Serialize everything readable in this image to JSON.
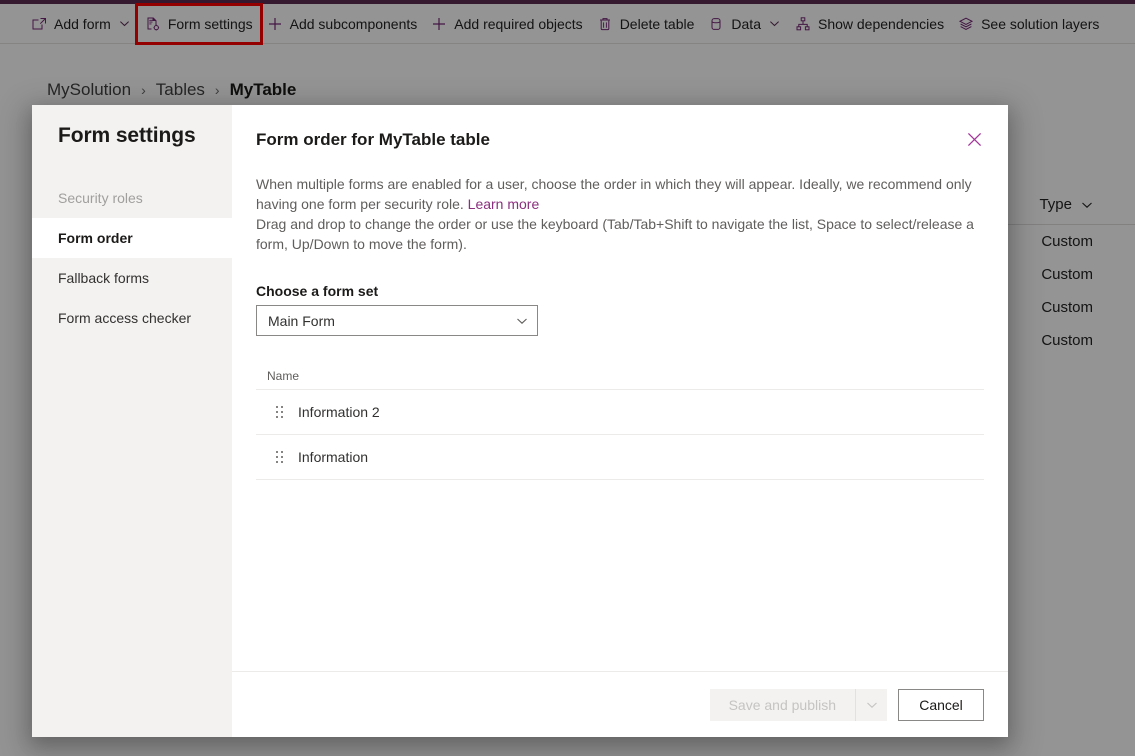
{
  "theme": {
    "accent_purple": "#5c2d52",
    "icon_purple": "#742774",
    "link_magenta": "#8b2e7e",
    "highlight_red": "#ff0000",
    "nav_selected_bg": "#ffffff",
    "nav_bg": "#f3f2f1"
  },
  "command_bar": {
    "items": [
      {
        "label": "Add form",
        "icon": "add-form-icon",
        "has_chevron": true
      },
      {
        "label": "Form settings",
        "icon": "form-settings-icon",
        "has_chevron": false,
        "highlighted": true
      },
      {
        "label": "Add subcomponents",
        "icon": "plus-icon",
        "has_chevron": false
      },
      {
        "label": "Add required objects",
        "icon": "plus-icon",
        "has_chevron": false
      },
      {
        "label": "Delete table",
        "icon": "trash-icon",
        "has_chevron": false
      },
      {
        "label": "Data",
        "icon": "database-icon",
        "has_chevron": true
      },
      {
        "label": "Show dependencies",
        "icon": "dependencies-icon",
        "has_chevron": false
      },
      {
        "label": "See solution layers",
        "icon": "layers-icon",
        "has_chevron": false
      }
    ]
  },
  "breadcrumb": {
    "separator": "›",
    "items": [
      {
        "label": "MySolution",
        "current": false
      },
      {
        "label": "Tables",
        "current": false
      },
      {
        "label": "MyTable",
        "current": true
      }
    ]
  },
  "background_grid": {
    "column_header": "Type",
    "rows": [
      "Custom",
      "Custom",
      "Custom",
      "Custom"
    ]
  },
  "dialog": {
    "nav_title": "Form settings",
    "nav_items": [
      {
        "label": "Security roles",
        "state": "disabled"
      },
      {
        "label": "Form order",
        "state": "selected"
      },
      {
        "label": "Fallback forms",
        "state": "normal"
      },
      {
        "label": "Form access checker",
        "state": "normal"
      }
    ],
    "title": "Form order for MyTable table",
    "close_icon": "close-icon",
    "description_part1": "When multiple forms are enabled for a user, choose the order in which they will appear. Ideally, we recommend only having one form per security role. ",
    "learn_more_label": "Learn more",
    "description_part2": "Drag and drop to change the order or use the keyboard (Tab/Tab+Shift to navigate the list, Space to select/release a form, Up/Down to move the form).",
    "form_set_label": "Choose a form set",
    "form_set_value": "Main Form",
    "list_header_name": "Name",
    "list_rows": [
      {
        "name": "Information 2"
      },
      {
        "name": "Information"
      }
    ],
    "footer": {
      "save_label": "Save and publish",
      "save_disabled": true,
      "cancel_label": "Cancel"
    }
  }
}
